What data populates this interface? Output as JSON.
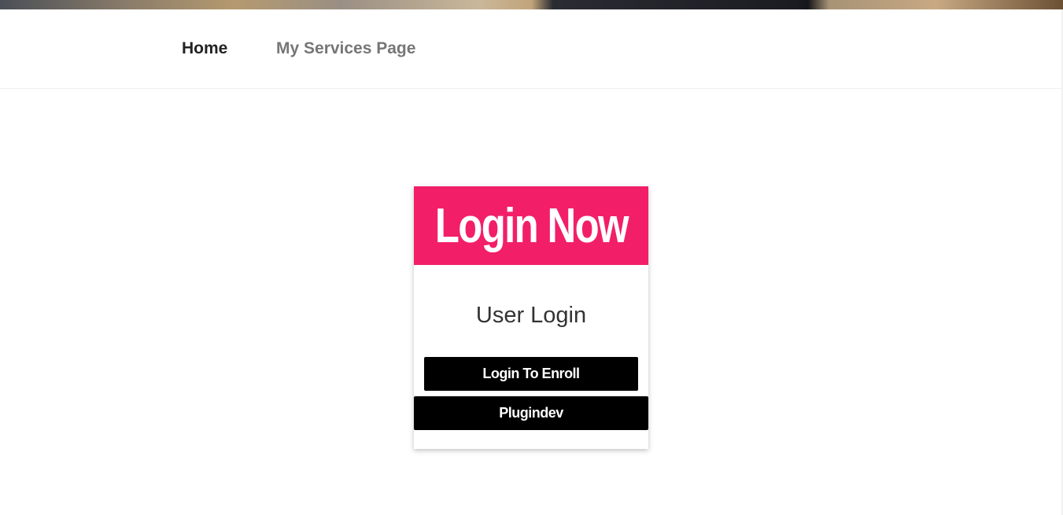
{
  "nav": {
    "items": [
      {
        "label": "Home"
      },
      {
        "label": "My Services Page"
      }
    ]
  },
  "card": {
    "header_title": "Login Now",
    "subtitle": "User Login",
    "enroll_button": "Login To Enroll",
    "plugindev_button": "Plugindev"
  },
  "colors": {
    "header_accent": "#f21f68",
    "button_bg": "#000000",
    "nav_active": "#222222",
    "nav_inactive": "#767676"
  }
}
